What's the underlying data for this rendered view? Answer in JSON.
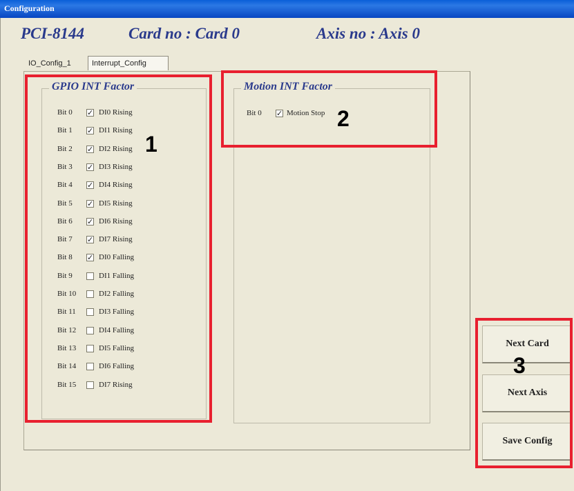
{
  "window": {
    "title": "Configuration"
  },
  "header": {
    "model": "PCI-8144",
    "card": "Card no : Card  0",
    "axis": "Axis no : Axis  0"
  },
  "tabs": [
    {
      "label": "IO_Config_1",
      "selected": false
    },
    {
      "label": "Interrupt_Config",
      "selected": true
    }
  ],
  "gpio": {
    "title": "GPIO INT Factor",
    "rows": [
      {
        "bit": "Bit 0",
        "label": "DI0 Rising",
        "checked": true
      },
      {
        "bit": "Bit 1",
        "label": "DI1 Rising",
        "checked": true
      },
      {
        "bit": "Bit 2",
        "label": "DI2 Rising",
        "checked": true
      },
      {
        "bit": "Bit 3",
        "label": "DI3 Rising",
        "checked": true
      },
      {
        "bit": "Bit 4",
        "label": "DI4 Rising",
        "checked": true
      },
      {
        "bit": "Bit 5",
        "label": "DI5 Rising",
        "checked": true
      },
      {
        "bit": "Bit 6",
        "label": "DI6 Rising",
        "checked": true
      },
      {
        "bit": "Bit 7",
        "label": "DI7 Rising",
        "checked": true
      },
      {
        "bit": "Bit 8",
        "label": "DI0 Falling",
        "checked": true
      },
      {
        "bit": "Bit 9",
        "label": "DI1 Falling",
        "checked": false
      },
      {
        "bit": "Bit 10",
        "label": "DI2 Falling",
        "checked": false
      },
      {
        "bit": "Bit 11",
        "label": "DI3 Falling",
        "checked": false
      },
      {
        "bit": "Bit 12",
        "label": "DI4 Falling",
        "checked": false
      },
      {
        "bit": "Bit 13",
        "label": "DI5 Falling",
        "checked": false
      },
      {
        "bit": "Bit 14",
        "label": "DI6 Falling",
        "checked": false
      },
      {
        "bit": "Bit 15",
        "label": "DI7 Rising",
        "checked": false
      }
    ]
  },
  "motion": {
    "title": "Motion INT Factor",
    "rows": [
      {
        "bit": "Bit 0",
        "label": "Motion Stop",
        "checked": true
      }
    ]
  },
  "buttons": {
    "next_card": "Next Card",
    "next_axis": "Next Axis",
    "save_config": "Save Config"
  },
  "annotations": {
    "n1": "1",
    "n2": "2",
    "n3": "3"
  },
  "colors": {
    "accent": "#2a3a8c",
    "highlight": "#e8202f",
    "titlebar": "#0a5fd8"
  }
}
